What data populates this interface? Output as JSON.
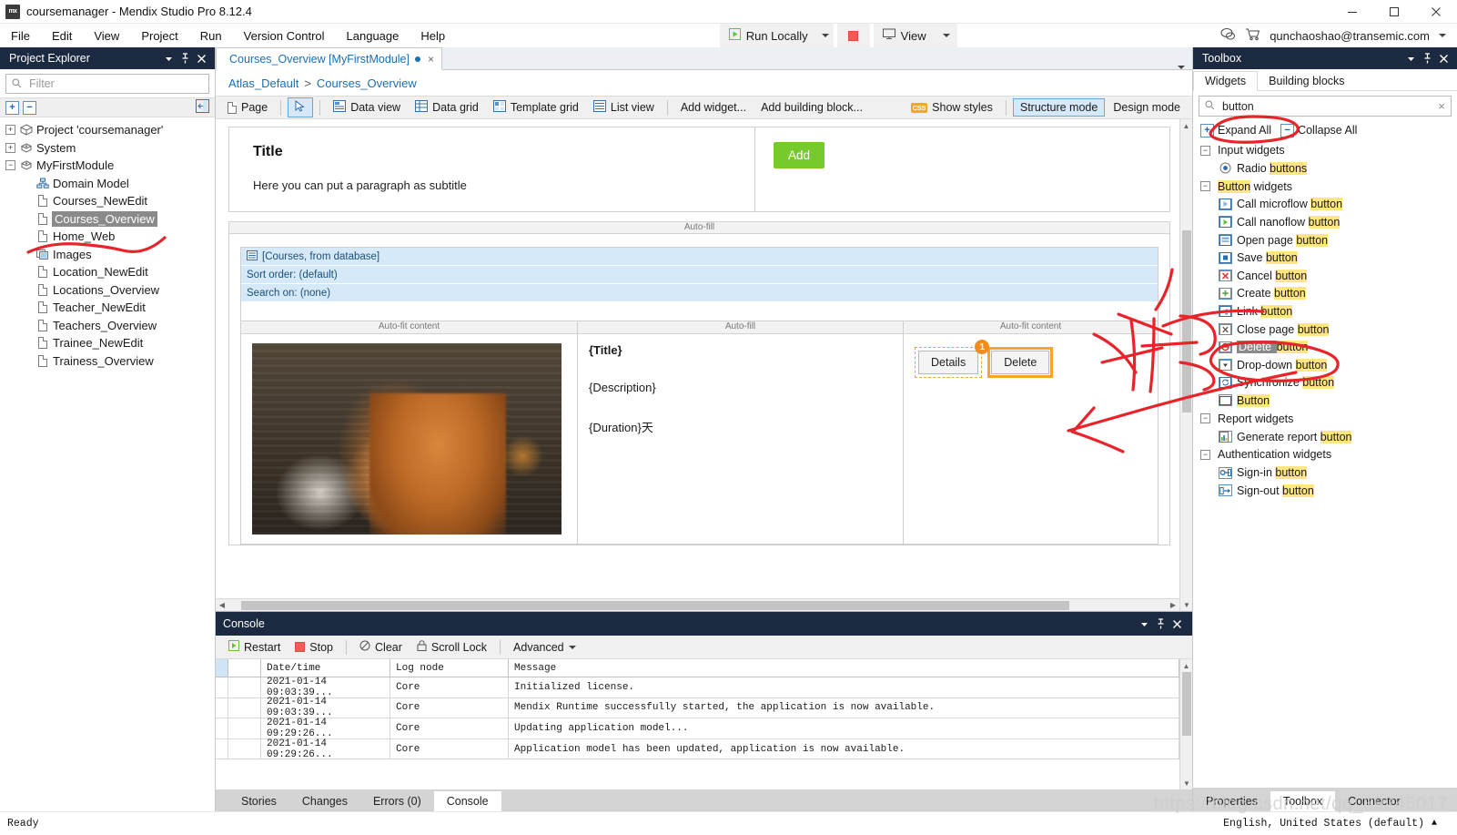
{
  "window": {
    "title": "coursemanager - Mendix Studio Pro 8.12.4",
    "app_icon": "mx",
    "minimize": "minimize-icon",
    "maximize": "maximize-icon",
    "close": "close-icon"
  },
  "menubar": {
    "items": [
      "File",
      "Edit",
      "View",
      "Project",
      "Run",
      "Version Control",
      "Language",
      "Help"
    ],
    "run_locally": "Run Locally",
    "view": "View",
    "account": "qunchaoshao@transemic.com"
  },
  "project_explorer": {
    "title": "Project Explorer",
    "filter_placeholder": "Filter",
    "filter_value": "",
    "expand_all": "expand-all",
    "collapse_all": "collapse-all",
    "tree": [
      {
        "label": "Project 'coursemanager'",
        "indent": 0,
        "expander": "+",
        "icon": "project-icon",
        "selected": false
      },
      {
        "label": "System",
        "indent": 0,
        "expander": "+",
        "icon": "module-icon",
        "selected": false
      },
      {
        "label": "MyFirstModule",
        "indent": 0,
        "expander": "-",
        "icon": "module-icon",
        "selected": false
      },
      {
        "label": "Domain Model",
        "indent": 1,
        "expander": "",
        "icon": "domain-model-icon",
        "selected": false
      },
      {
        "label": "Courses_NewEdit",
        "indent": 1,
        "expander": "",
        "icon": "page-icon",
        "selected": false
      },
      {
        "label": "Courses_Overview",
        "indent": 1,
        "expander": "",
        "icon": "page-icon",
        "selected": true
      },
      {
        "label": "Home_Web",
        "indent": 1,
        "expander": "",
        "icon": "page-icon",
        "selected": false
      },
      {
        "label": "Images",
        "indent": 1,
        "expander": "",
        "icon": "images-icon",
        "selected": false
      },
      {
        "label": "Location_NewEdit",
        "indent": 1,
        "expander": "",
        "icon": "page-icon",
        "selected": false
      },
      {
        "label": "Locations_Overview",
        "indent": 1,
        "expander": "",
        "icon": "page-icon",
        "selected": false
      },
      {
        "label": "Teacher_NewEdit",
        "indent": 1,
        "expander": "",
        "icon": "page-icon",
        "selected": false
      },
      {
        "label": "Teachers_Overview",
        "indent": 1,
        "expander": "",
        "icon": "page-icon",
        "selected": false
      },
      {
        "label": "Trainee_NewEdit",
        "indent": 1,
        "expander": "",
        "icon": "page-icon",
        "selected": false
      },
      {
        "label": "Trainess_Overview",
        "indent": 1,
        "expander": "",
        "icon": "page-icon",
        "selected": false
      }
    ]
  },
  "editor": {
    "tab_label": "Courses_Overview [MyFirstModule]",
    "tab_dirty": true,
    "breadcrumb_root": "Atlas_Default",
    "breadcrumb_sep": ">",
    "breadcrumb_leaf": "Courses_Overview",
    "toolbar": {
      "page": "Page",
      "pointer": "pointer-icon",
      "data_view": "Data view",
      "data_grid": "Data grid",
      "template_grid": "Template grid",
      "list_view": "List view",
      "add_widget": "Add widget...",
      "add_building_block": "Add building block...",
      "show_styles": "Show styles",
      "structure_mode": "Structure mode",
      "design_mode": "Design mode"
    },
    "canvas": {
      "header_title": "Title",
      "header_subtitle": "Here you can put a paragraph as subtitle",
      "add_button": "Add",
      "autofill_label": "Auto-fill",
      "autofit_label": "Auto-fit content",
      "listview_source": "[Courses, from database]",
      "sort_order": "Sort order: (default)",
      "search_on": "Search on: (none)",
      "cell_title": "{Title}",
      "cell_description": "{Description}",
      "cell_duration": "{Duration}天",
      "details_button": "Details",
      "details_badge": "1",
      "delete_button": "Delete"
    }
  },
  "console": {
    "title": "Console",
    "toolbar": {
      "restart": "Restart",
      "stop": "Stop",
      "clear": "Clear",
      "scroll_lock": "Scroll Lock",
      "advanced": "Advanced"
    },
    "columns": [
      "Date/time",
      "Log node",
      "Message"
    ],
    "rows": [
      {
        "datetime": "2021-01-14 09:03:39...",
        "node": "Core",
        "message": "Initialized license."
      },
      {
        "datetime": "2021-01-14 09:03:39...",
        "node": "Core",
        "message": "Mendix Runtime successfully started, the application is now available."
      },
      {
        "datetime": "2021-01-14 09:29:26...",
        "node": "Core",
        "message": "Updating application model..."
      },
      {
        "datetime": "2021-01-14 09:29:26...",
        "node": "Core",
        "message": "Application model has been updated, application is now available."
      }
    ],
    "tabs": [
      {
        "label": "Stories",
        "active": false
      },
      {
        "label": "Changes",
        "active": false
      },
      {
        "label": "Errors (0)",
        "active": false
      },
      {
        "label": "Console",
        "active": true
      }
    ]
  },
  "toolbox": {
    "title": "Toolbox",
    "tabs": [
      {
        "label": "Widgets",
        "active": true
      },
      {
        "label": "Building blocks",
        "active": false
      }
    ],
    "search_value": "button",
    "search_placeholder": "",
    "expand_all": "Expand All",
    "collapse_all": "Collapse All",
    "groups": [
      {
        "label": "Input widgets",
        "highlight": "",
        "items": [
          {
            "pre": "Radio ",
            "hl": "buttons",
            "post": "",
            "icon": "radio-button-icon",
            "selected": false
          }
        ]
      },
      {
        "label": "Button widgets",
        "highlight": "Button",
        "items": [
          {
            "pre": "Call microflow ",
            "hl": "button",
            "post": "",
            "icon": "microflow-icon",
            "selected": false
          },
          {
            "pre": "Call nanoflow ",
            "hl": "button",
            "post": "",
            "icon": "nanoflow-icon",
            "selected": false
          },
          {
            "pre": "Open page ",
            "hl": "button",
            "post": "",
            "icon": "open-page-icon",
            "selected": false
          },
          {
            "pre": "Save ",
            "hl": "button",
            "post": "",
            "icon": "save-icon",
            "selected": false
          },
          {
            "pre": "Cancel ",
            "hl": "button",
            "post": "",
            "icon": "cancel-icon",
            "selected": false
          },
          {
            "pre": "Create ",
            "hl": "button",
            "post": "",
            "icon": "create-icon",
            "selected": false
          },
          {
            "pre": "Link ",
            "hl": "button",
            "post": "",
            "icon": "link-icon",
            "selected": false
          },
          {
            "pre": "Close page ",
            "hl": "button",
            "post": "",
            "icon": "close-page-icon",
            "selected": false
          },
          {
            "pre": "Delete ",
            "hl": "button",
            "post": "",
            "icon": "delete-icon",
            "selected": true
          },
          {
            "pre": "Drop-down ",
            "hl": "button",
            "post": "",
            "icon": "dropdown-icon",
            "selected": false
          },
          {
            "pre": "Synchronize ",
            "hl": "button",
            "post": "",
            "icon": "sync-icon",
            "selected": false
          },
          {
            "pre": "",
            "hl": "Button",
            "post": "",
            "icon": "button-icon",
            "selected": false
          }
        ]
      },
      {
        "label": "Report widgets",
        "highlight": "",
        "items": [
          {
            "pre": "Generate report ",
            "hl": "button",
            "post": "",
            "icon": "report-icon",
            "selected": false
          }
        ]
      },
      {
        "label": "Authentication widgets",
        "highlight": "",
        "items": [
          {
            "pre": "Sign-in ",
            "hl": "button",
            "post": "",
            "icon": "signin-icon",
            "selected": false
          },
          {
            "pre": "Sign-out ",
            "hl": "button",
            "post": "",
            "icon": "signout-icon",
            "selected": false
          }
        ]
      }
    ],
    "footer_tabs": [
      {
        "label": "Properties",
        "active": false
      },
      {
        "label": "Toolbox",
        "active": true
      },
      {
        "label": "Connector",
        "active": false
      }
    ]
  },
  "statusbar": {
    "ready": "Ready",
    "language": "English, United States (default)"
  },
  "watermark": "https://blog.csdn.net/qq_39245017",
  "colors": {
    "accent_blue": "#1a6fb5",
    "panel_header": "#1b2a41",
    "highlight_yellow": "#ffe680",
    "annotation_red": "#e8232a",
    "orange_selection": "#f5a623",
    "add_green": "#76ca2c"
  }
}
